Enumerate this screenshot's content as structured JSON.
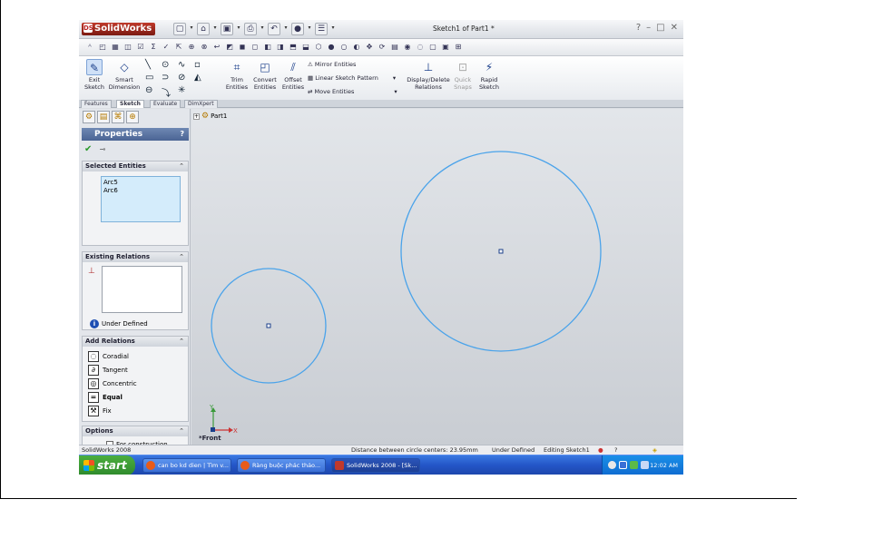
{
  "titlebar": {
    "app_name": "SolidWorks",
    "logo_icon": "ds-logo-icon",
    "document_title": "Sketch1 of Part1 *",
    "help": "?",
    "minimize": "–",
    "restore": "□",
    "close": "✕"
  },
  "ribbon": {
    "exit_sketch": "Exit Sketch",
    "smart_dimension": "Smart Dimension",
    "trim_entities": "Trim Entities",
    "convert_entities": "Convert Entities",
    "offset_entities": "Offset Entities",
    "mirror_entities": "Mirror Entities",
    "linear_sketch_pattern": "Linear Sketch Pattern",
    "move_entities": "Move Entities",
    "display_delete_relations": "Display/Delete Relations",
    "quick_snaps": "Quick Snaps",
    "rapid_sketch": "Rapid Sketch"
  },
  "tabs": [
    "Features",
    "Sketch",
    "Evaluate",
    "DimXpert"
  ],
  "panel": {
    "title": "Properties",
    "help": "?",
    "selected_entities": {
      "heading": "Selected Entities",
      "items": [
        "Arc5",
        "Arc6"
      ]
    },
    "existing_relations": {
      "heading": "Existing Relations",
      "status": "Under Defined"
    },
    "add_relations": {
      "heading": "Add Relations",
      "items": [
        {
          "label": "Coradial",
          "icon": "coradial-icon"
        },
        {
          "label": "Tangent",
          "icon": "tangent-icon"
        },
        {
          "label": "Concentric",
          "icon": "concentric-icon"
        },
        {
          "label": "Equal",
          "icon": "equal-icon"
        },
        {
          "label": "Fix",
          "icon": "fix-icon"
        }
      ]
    },
    "options": {
      "heading": "Options",
      "for_construction": "For construction"
    }
  },
  "canvas": {
    "tree_root": "Part1",
    "view_label": "*Front",
    "axis_x": "X",
    "axis_y": "Y",
    "circle_color": "#4aa3ea"
  },
  "statusbar": {
    "app": "SolidWorks 2008",
    "measure": "Distance between circle centers:  23.95mm",
    "state": "Under Defined",
    "mode": "Editing Sketch1"
  },
  "taskbar": {
    "start": "start",
    "buttons": [
      "can bo kd dien | Tìm v...",
      "Ràng buộc phác thảo...",
      "SolidWorks 2008 - [Sk..."
    ],
    "clock": "12:02 AM"
  }
}
